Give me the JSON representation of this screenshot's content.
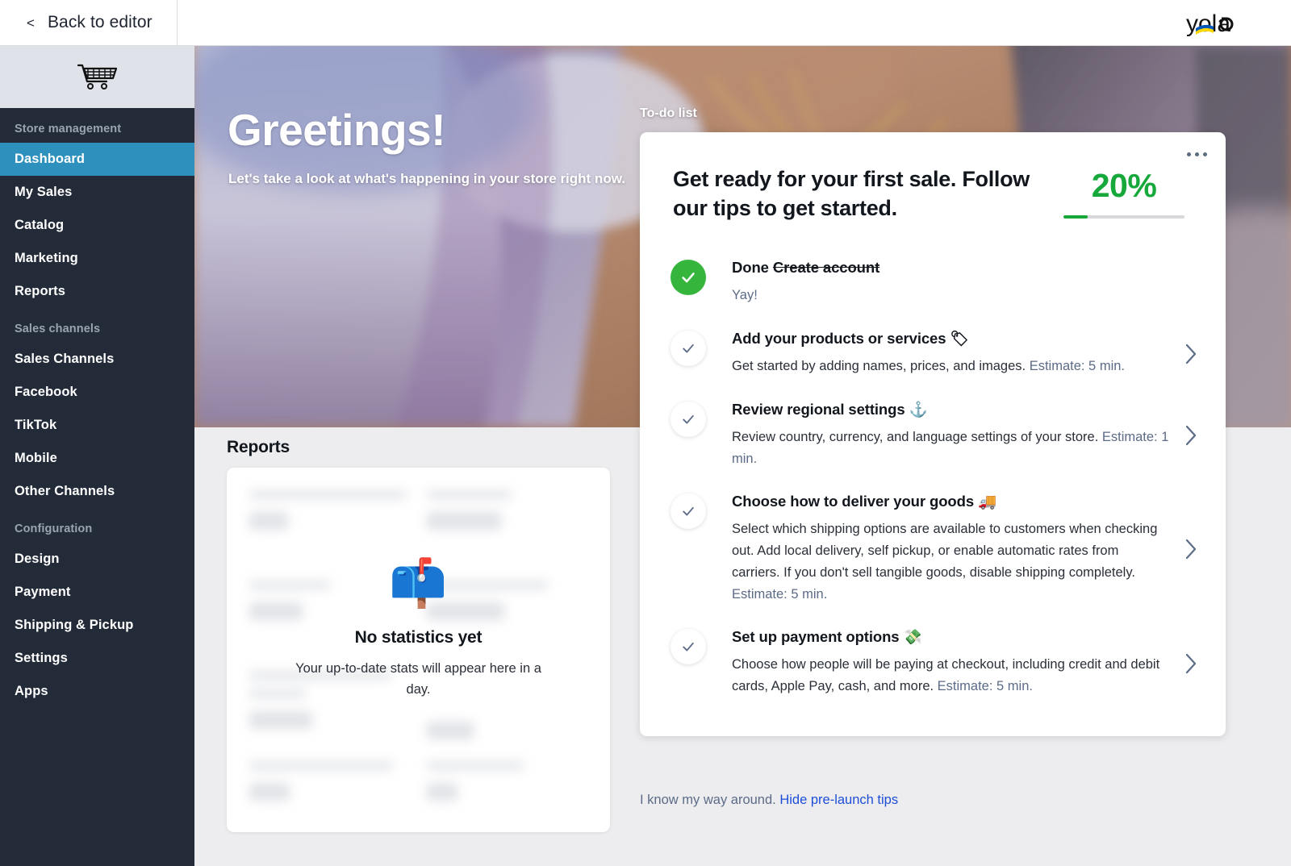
{
  "topbar": {
    "back_chevron": "<",
    "back_label": "Back to editor",
    "logo_text": "yola",
    "logo_name": "yola-logo"
  },
  "sidebar": {
    "cart_icon": "shopping-cart-icon",
    "groups": [
      {
        "title": "Store management",
        "items": [
          {
            "label": "Dashboard",
            "active": true
          },
          {
            "label": "My Sales",
            "active": false
          },
          {
            "label": "Catalog",
            "active": false
          },
          {
            "label": "Marketing",
            "active": false
          },
          {
            "label": "Reports",
            "active": false
          }
        ]
      },
      {
        "title": "Sales channels",
        "items": [
          {
            "label": "Sales Channels",
            "active": false
          },
          {
            "label": "Facebook",
            "active": false
          },
          {
            "label": "TikTok",
            "active": false
          },
          {
            "label": "Mobile",
            "active": false
          },
          {
            "label": "Other Channels",
            "active": false
          }
        ]
      },
      {
        "title": "Configuration",
        "items": [
          {
            "label": "Design",
            "active": false
          },
          {
            "label": "Payment",
            "active": false
          },
          {
            "label": "Shipping & Pickup",
            "active": false
          },
          {
            "label": "Settings",
            "active": false
          },
          {
            "label": "Apps",
            "active": false
          }
        ]
      }
    ]
  },
  "hero": {
    "title": "Greetings!",
    "subtitle": "Let's take a look at what's happening in your store right now."
  },
  "todo": {
    "section_label": "To-do list",
    "heading": "Get ready for your first sale. Follow our tips to get started.",
    "progress_percent": "20%",
    "progress_value": 20,
    "menu_icon": "kebab-menu-icon",
    "items": [
      {
        "state": "done",
        "title_prefix": "Done ",
        "title_struck": "Create account",
        "description": "Yay!",
        "estimate": "",
        "emoji": "",
        "has_chevron": false
      },
      {
        "state": "todo",
        "title_prefix": "Add your products or services ",
        "title_struck": "",
        "emoji": "🏷",
        "description": "Get started by adding names, prices, and images. ",
        "estimate": "Estimate: 5 min.",
        "has_chevron": true
      },
      {
        "state": "todo",
        "title_prefix": "Review regional settings ",
        "title_struck": "",
        "emoji": "⚓",
        "description": "Review country, currency, and language settings of your store. ",
        "estimate": "Estimate: 1 min.",
        "has_chevron": true
      },
      {
        "state": "todo",
        "title_prefix": "Choose how to deliver your goods ",
        "title_struck": "",
        "emoji": "🚚",
        "description": "Select which shipping options are available to customers when checking out. Add local delivery, self pickup, or enable automatic rates from carriers. If you don't sell tangible goods, disable shipping completely. ",
        "estimate": "Estimate: 5 min.",
        "has_chevron": true
      },
      {
        "state": "todo",
        "title_prefix": "Set up payment options ",
        "title_struck": "",
        "emoji": "💸",
        "description": "Choose how people will be paying at checkout, including credit and debit cards, Apple Pay, cash, and more. ",
        "estimate": "Estimate: 5 min.",
        "has_chevron": true
      }
    ],
    "footer_text": "I know my way around. ",
    "footer_link": "Hide pre-launch tips"
  },
  "reports": {
    "title": "Reports",
    "empty_emoji": "📫",
    "empty_title": "No statistics yet",
    "empty_subtitle": "Your up-to-date stats will appear here in a day."
  },
  "colors": {
    "sidebar_bg": "#232b38",
    "sidebar_active": "#2d90bd",
    "accent_green": "#17a83b",
    "check_green": "#35b53c",
    "link_blue": "#1d4ed8",
    "muted_slate": "#5c6b87",
    "page_bg": "#ededef"
  }
}
